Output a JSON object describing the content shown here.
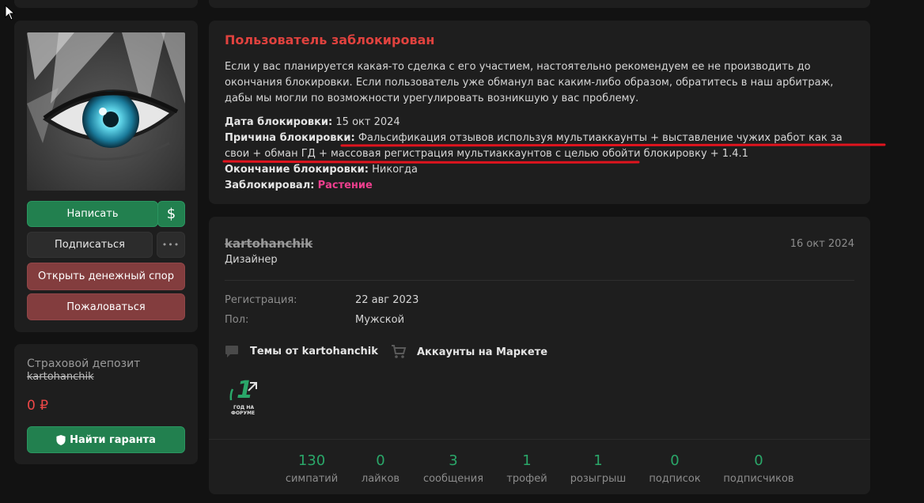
{
  "ban": {
    "title": "Пользователь заблокирован",
    "description": "Если у вас планируется какая-то сделка с его участием, настоятельно рекомендуем ее не производить до окончания блокировки. Если пользователь уже обманул вас каким-либо образом, обратитесь в наш арбитраж, дабы мы могли по возможности урегулировать возникшую у вас проблему.",
    "date_label": "Дата блокировки:",
    "date_value": "15 окт 2024",
    "reason_label": "Причина блокировки:",
    "reason_value": "Фальсификация отзывов используя мультиаккаунты + выставление чужих работ как за свои + обман ГД + массовая регистрация мультиаккаунтов с целью обойти блокировку + 1.4.1",
    "end_label": "Окончание блокировки:",
    "end_value": "Никогда",
    "by_label": "Заблокировал:",
    "by_value": "Растение"
  },
  "actions": {
    "write": "Написать",
    "dollar": "$",
    "subscribe": "Подписаться",
    "more": "•••",
    "dispute": "Открыть денежный спор",
    "report": "Пожаловаться"
  },
  "deposit": {
    "title": "Страховой депозит",
    "username": "kartohanchik",
    "amount": "0 ₽",
    "guarantor_button": "Найти гаранта"
  },
  "profile": {
    "username": "kartohanchik",
    "role": "Дизайнер",
    "date": "16 окт 2024",
    "reg_label": "Регистрация:",
    "reg_value": "22 авг 2023",
    "gender_label": "Пол:",
    "gender_value": "Мужской",
    "threads_link": "Темы от kartohanchik",
    "market_link": "Аккаунты на Маркете",
    "badge": {
      "number": "1",
      "line1": "ГОД НА",
      "line2": "ФОРУМЕ"
    }
  },
  "stats": [
    {
      "value": "130",
      "label": "симпатий"
    },
    {
      "value": "0",
      "label": "лайков"
    },
    {
      "value": "3",
      "label": "сообщения"
    },
    {
      "value": "1",
      "label": "трофей"
    },
    {
      "value": "1",
      "label": "розыгрыш"
    },
    {
      "value": "0",
      "label": "подписок"
    },
    {
      "value": "0",
      "label": "подписчиков"
    }
  ],
  "colors": {
    "accent_green": "#2aa769",
    "ban_red": "#e0423e",
    "banner_pink": "#ee3f8e",
    "underline_red": "#e0141e"
  }
}
